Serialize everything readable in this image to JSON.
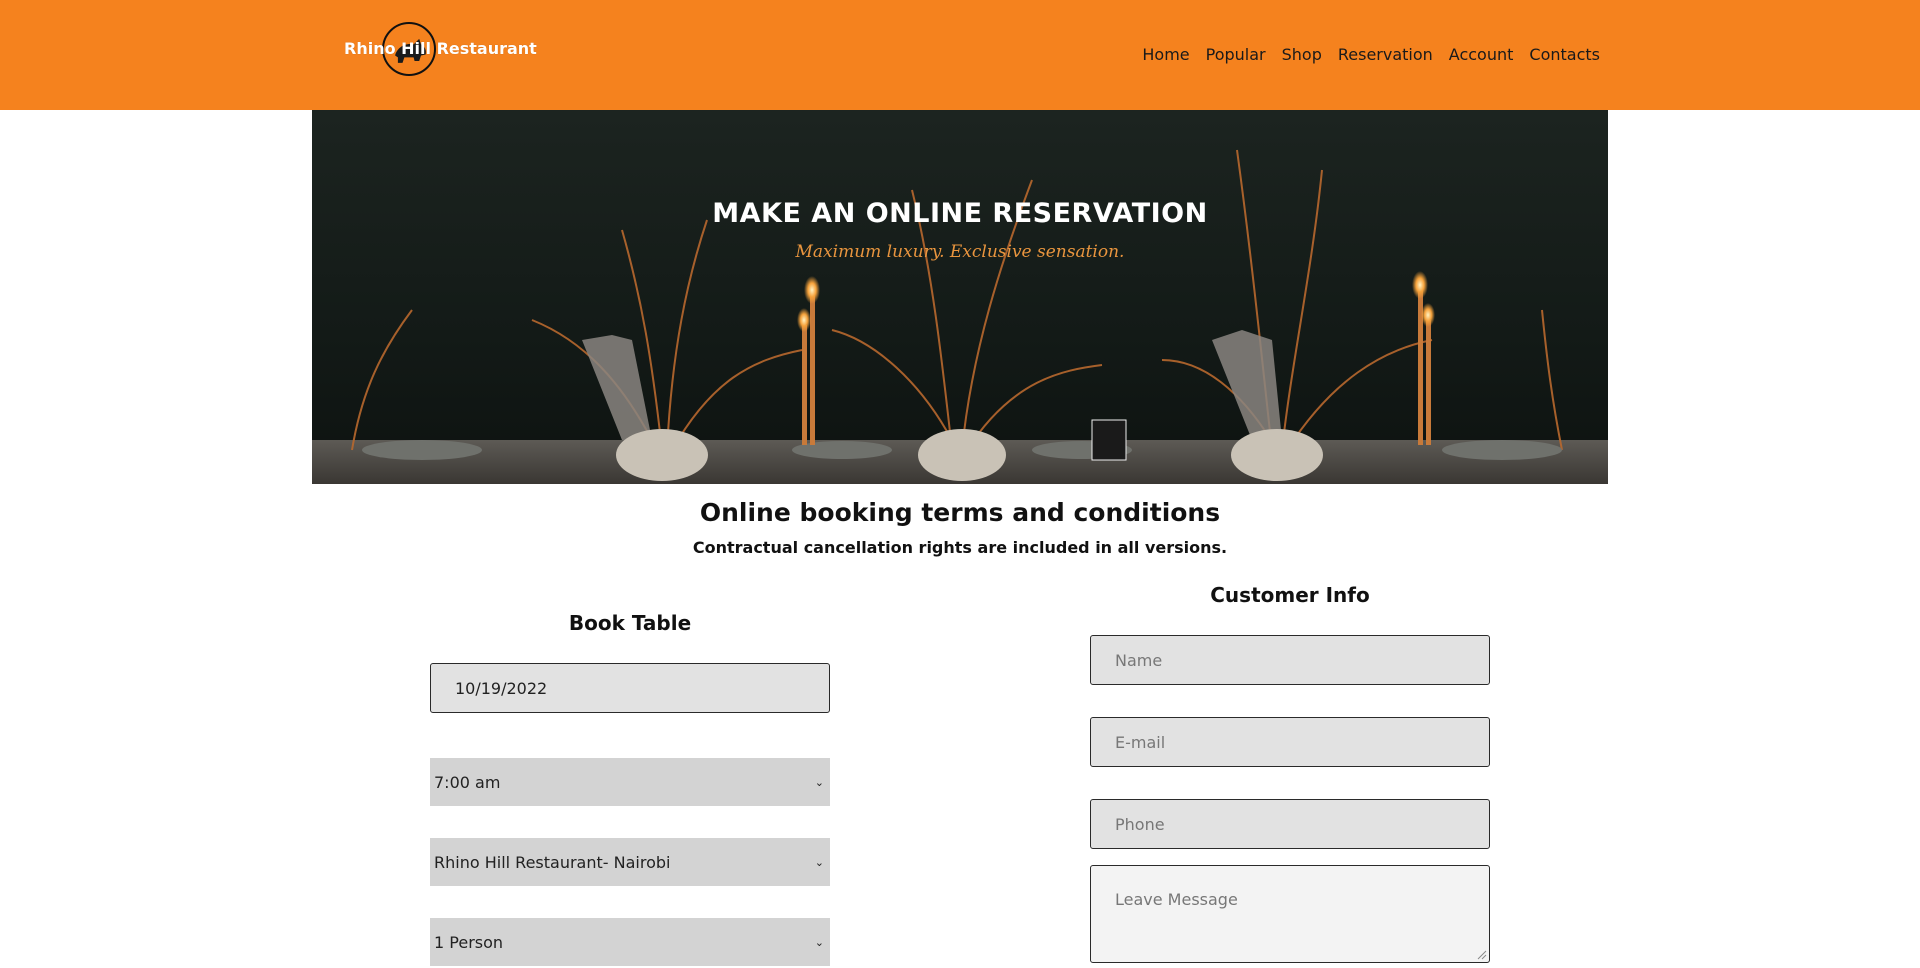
{
  "brand": {
    "name": "Rhino Hill Restaurant",
    "logo_icon": "rhino-logo-icon",
    "accent_color": "#f5821e"
  },
  "nav": {
    "items": [
      "Home",
      "Popular",
      "Shop",
      "Reservation",
      "Account",
      "Contacts"
    ]
  },
  "hero": {
    "title": "MAKE AN ONLINE RESERVATION",
    "subtitle": "Maximum luxury. Exclusive sensation."
  },
  "terms": {
    "title": "Online booking terms and conditions",
    "subtitle": "Contractual cancellation rights are included in all versions."
  },
  "book_table": {
    "title": "Book Table",
    "date_value": "10/19/2022",
    "time_selected": "7:00 am",
    "location_selected": "Rhino Hill Restaurant- Nairobi",
    "party_selected": "1 Person"
  },
  "customer_info": {
    "title": "Customer Info",
    "name_placeholder": "Name",
    "email_placeholder": "E-mail",
    "phone_placeholder": "Phone",
    "message_placeholder": "Leave Message"
  }
}
